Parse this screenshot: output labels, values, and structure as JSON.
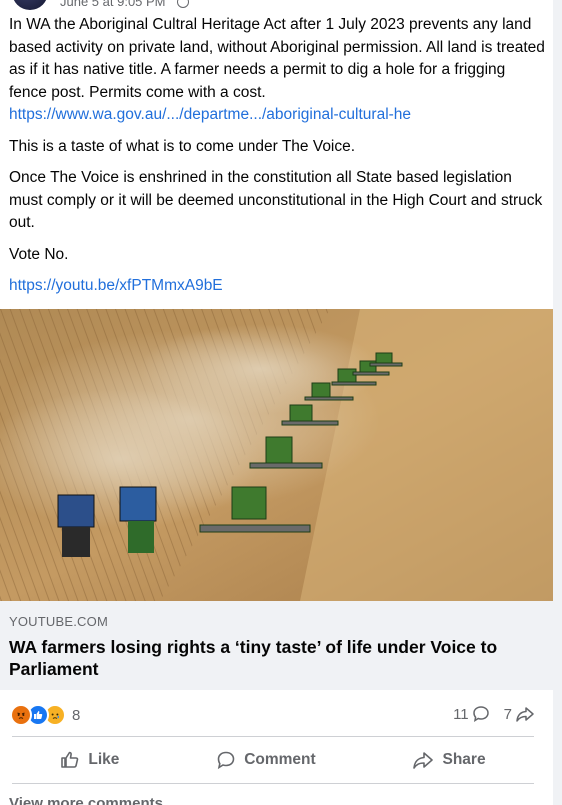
{
  "post": {
    "timestamp": "June 5 at 9:05 PM",
    "paragraphs": [
      "In WA the Aboriginal Cultral Heritage Act after 1 July 2023 prevents any land based activity on private land, without Aboriginal permission. All land is treated as if it has native title. A farmer needs a permit to dig a hole for a frigging fence post. Permits come with a cost.",
      "This is a taste of what is to come under The Voice.",
      "Once The Voice is enshrined in the constitution all State based legislation must comply or it will be deemed unconstitutional in the High Court and struck out.",
      "Vote No."
    ],
    "link_1": "https://www.wa.gov.au/.../departme.../aboriginal-cultural-he",
    "link_2": "https://youtu.be/xfPTMmxA9bE"
  },
  "link_card": {
    "domain": "YOUTUBE.COM",
    "headline": "WA farmers losing rights a ‘tiny taste’ of life under Voice to Parliament"
  },
  "stats": {
    "reaction_icons": [
      "angry-icon",
      "like-icon",
      "sad-icon"
    ],
    "reaction_count": "8",
    "comment_count": "11",
    "share_count": "7"
  },
  "actions": {
    "like": "Like",
    "comment": "Comment",
    "share": "Share"
  },
  "footer": {
    "view_more": "View more comments"
  },
  "colors": {
    "link": "#216fdb",
    "muted": "#65676b",
    "like_blue": "#1877f2",
    "angry_orange": "#e9710f",
    "sad_yellow": "#f7b125"
  }
}
